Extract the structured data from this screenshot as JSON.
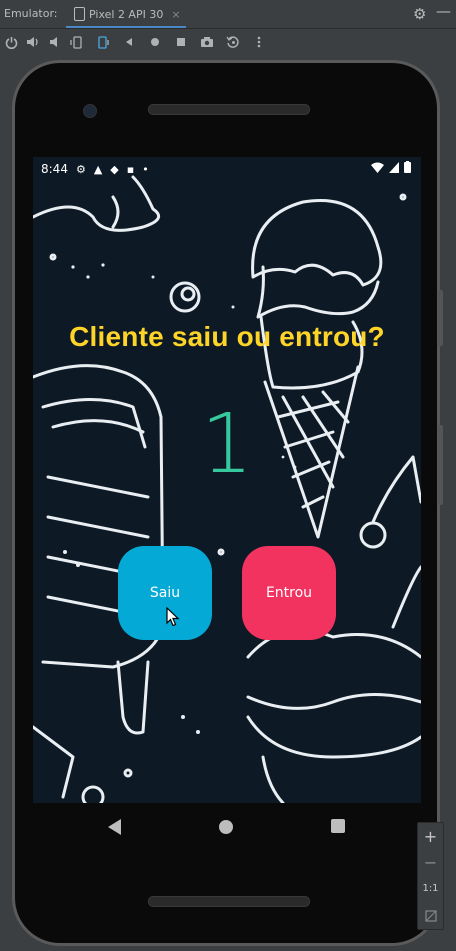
{
  "emulator": {
    "label": "Emulator:",
    "device_tab": "Pixel 2 API 30",
    "tab_close": "×",
    "settings_icon": "gear-icon",
    "minimize_icon": "minus-icon"
  },
  "toolbar": {
    "icons": [
      "power-icon",
      "volume-up-icon",
      "volume-down-icon",
      "rotate-left-icon",
      "rotate-right-icon",
      "back-icon",
      "home-icon",
      "overview-icon",
      "screenshot-icon",
      "snapshot-icon",
      "more-icon"
    ]
  },
  "status_bar": {
    "time": "8:44"
  },
  "app": {
    "title": "Cliente saiu ou entrou?",
    "count": "1",
    "saiu_label": "Saiu",
    "entrou_label": "Entrou",
    "colors": {
      "title": "#ffd428",
      "count": "#36c99e",
      "saiu": "#05a9d5",
      "entrou": "#f2325f",
      "background": "#0d1a26"
    }
  },
  "zoom": {
    "plus": "+",
    "minus": "−",
    "ratio": "1:1"
  }
}
